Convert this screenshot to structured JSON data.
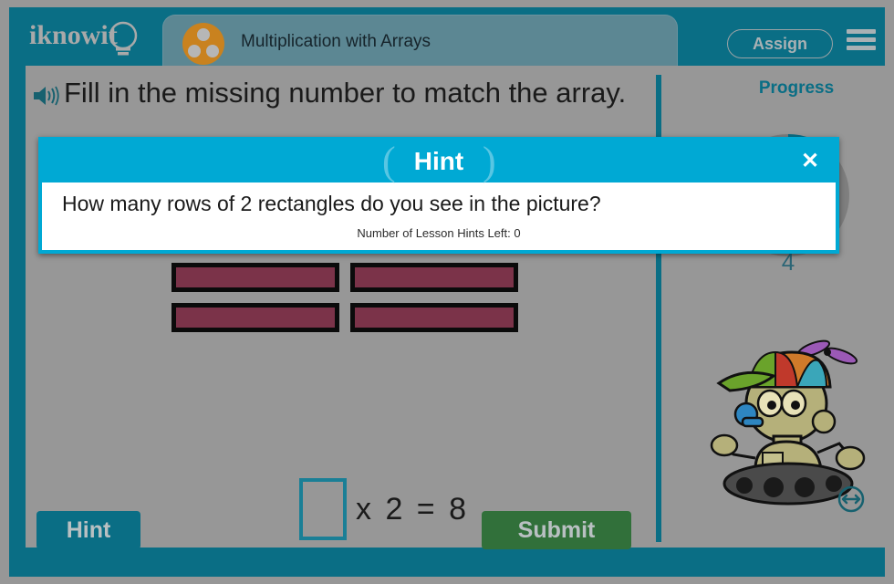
{
  "header": {
    "logo_text": "iknowit",
    "logo_icon": "lightbulb-icon",
    "lesson_title": "Multiplication with Arrays",
    "lesson_badge_icon": "three-dots-circle-icon",
    "assign_label": "Assign",
    "menu_icon": "hamburger-menu-icon"
  },
  "question": {
    "audio_icon": "speaker-icon",
    "text": "Fill in the missing number to match the array."
  },
  "array": {
    "rows": 4,
    "columns": 2,
    "rect_color": "#7b3349",
    "rect_border_color": "#0b0b0b"
  },
  "equation": {
    "answer_value": "",
    "answer_placeholder": "",
    "rest": "x 2 = 8"
  },
  "buttons": {
    "hint_label": "Hint",
    "submit_label": "Submit"
  },
  "progress": {
    "label": "Progress",
    "value": "4",
    "percent": 12,
    "ring_color": "#0a6e85",
    "track_color": "#7f7f7f"
  },
  "mascot": {
    "name": "robot-mascot",
    "resize_icon": "resize-horizontal-icon"
  },
  "hint_dialog": {
    "title": "Hint",
    "paren_left": "(",
    "paren_right": ")",
    "close_icon": "✕",
    "body_text": "How many rows of 2 rectangles do you see in the picture?",
    "hints_left_text": "Number of Lesson Hints Left: 0"
  },
  "colors": {
    "teal": "#0a6e85",
    "cyan": "#00a9d4",
    "green": "#31703a",
    "orange": "#c9821f",
    "page_bg": "#979797"
  }
}
